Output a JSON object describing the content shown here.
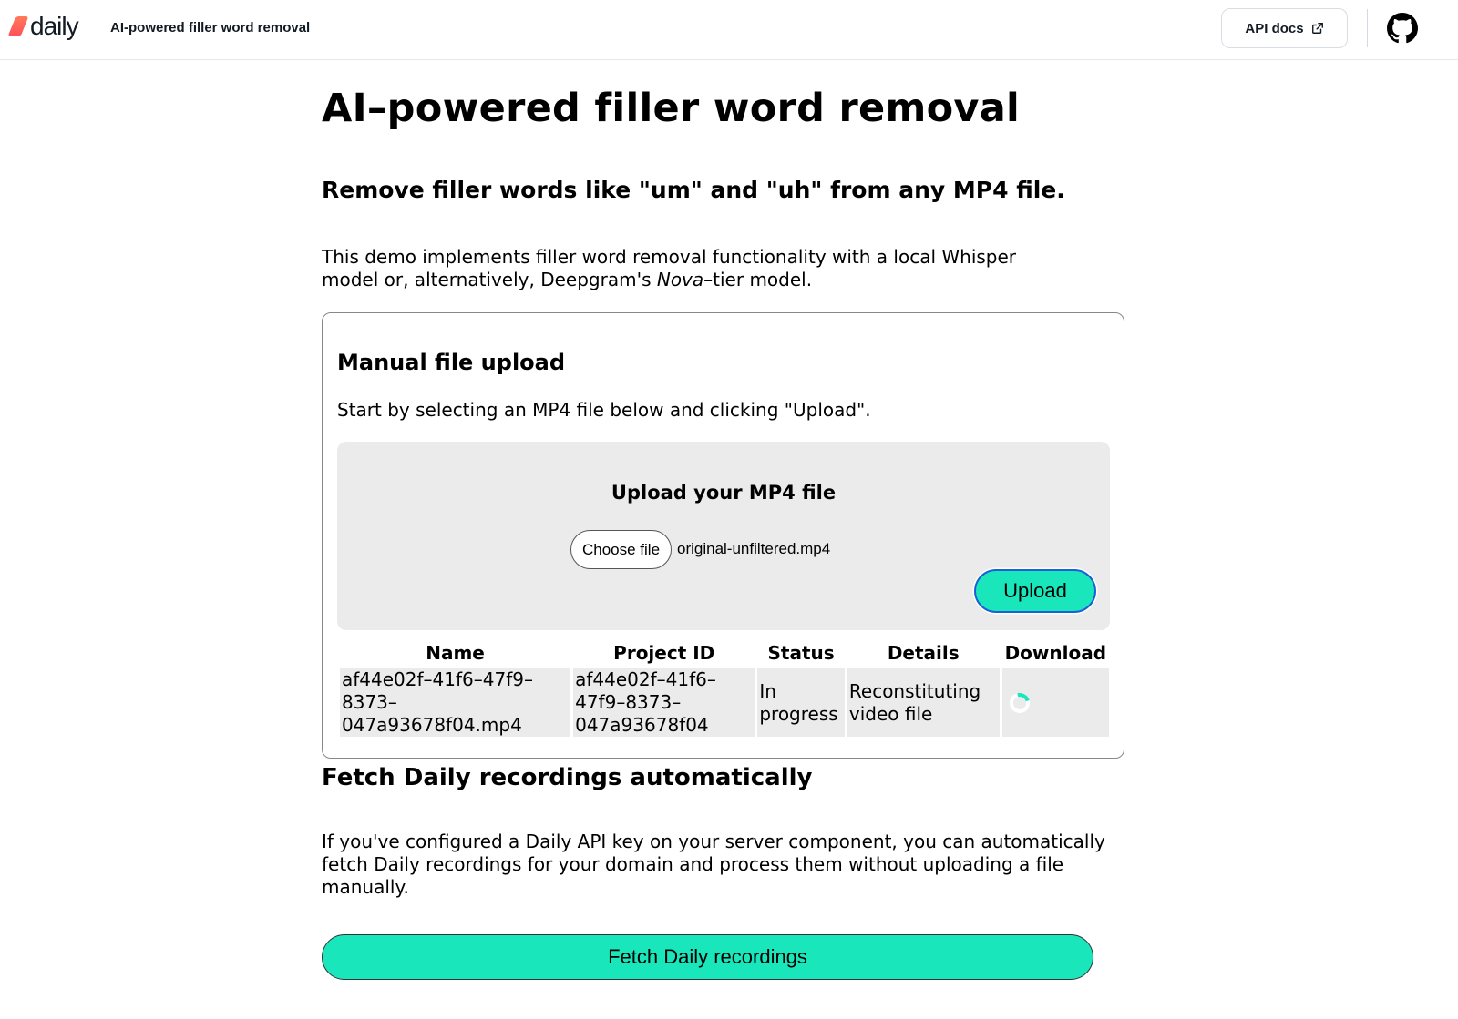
{
  "header": {
    "logo_text": "daily",
    "title": "AI-powered filler word removal",
    "api_docs_label": "API docs",
    "github_icon": "github-icon",
    "external_link_icon": "external-link-icon"
  },
  "main": {
    "page_title": "AI–powered filler word removal",
    "subtitle": "Remove filler words like \"um\" and \"uh\" from any MP4 file.",
    "intro_before": "This demo implements filler word removal functionality with a local Whisper model or, alternatively, Deepgram's ",
    "intro_em": "Nova",
    "intro_after": "–tier model."
  },
  "upload_card": {
    "title": "Manual file upload",
    "description": "Start by selecting an MP4 file below and clicking \"Upload\".",
    "box_title": "Upload your MP4 file",
    "choose_file_label": "Choose file",
    "selected_file": "original-unfiltered.mp4",
    "upload_label": "Upload"
  },
  "jobs_table": {
    "columns": [
      "Name",
      "Project ID",
      "Status",
      "Details",
      "Download"
    ],
    "rows": [
      {
        "name": "af44e02f–41f6–47f9–8373–047a93678f04.mp4",
        "project_id": "af44e02f–41f6–47f9–8373–047a93678f04",
        "status": "In progress",
        "details": "Reconstituting video file",
        "download": "loading-spinner"
      }
    ]
  },
  "fetch_section": {
    "title": "Fetch Daily recordings automatically",
    "description": "If you've configured a Daily API key on your server component, you can automatically fetch Daily recordings for your domain and process them without uploading a file manually.",
    "button_label": "Fetch Daily recordings"
  },
  "colors": {
    "accent": "#1ae6bb",
    "upload_border": "#1d5fd4",
    "panel_bg": "#ebebeb",
    "logo_gradient": [
      "#ff7a59",
      "#ff4f5a"
    ]
  }
}
